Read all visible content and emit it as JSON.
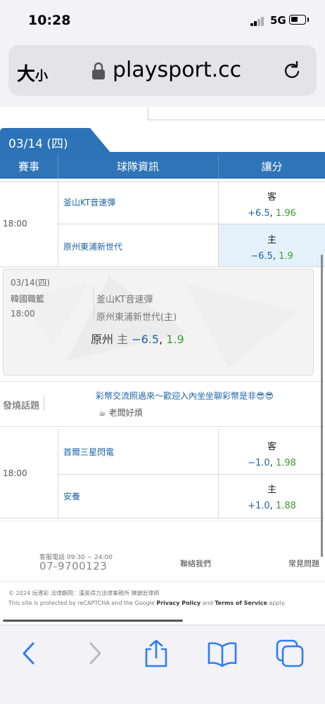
{
  "status_bar": {
    "time": "10:28",
    "network": "5G"
  },
  "browser": {
    "text_size_label": "大",
    "text_size_label_small": "小",
    "url": "playsport.cc"
  },
  "date_tab": {
    "label": "03/14 (四)"
  },
  "table": {
    "headers": [
      "賽事",
      "球隊資訊",
      "讓分"
    ],
    "matches": [
      {
        "time": "18:00",
        "away_team": "釜山KT音速彈",
        "away_side": "客",
        "away_line": "+6.5",
        "away_odds": "1.96",
        "home_team": "原州東浦新世代",
        "home_side": "主",
        "home_line": "−6.5",
        "home_odds": "1.9"
      },
      {
        "time": "18:00",
        "away_team": "首爾三星閃電",
        "away_side": "客",
        "away_line": "−1.0",
        "away_odds": "1.98",
        "home_team": "安養",
        "home_side": "主",
        "home_line": "+1.0",
        "home_odds": "1.88"
      }
    ]
  },
  "pick_card": {
    "date": "03/14(四)",
    "league": "韓國職籃",
    "time": "18:00",
    "team1": "釜山KT音速彈",
    "team2": "原州東浦新世代(主)",
    "pick_team": "原州",
    "pick_side": "主",
    "pick_line": "−6.5",
    "pick_sep": ",",
    "pick_odds": "1.9"
  },
  "topic": {
    "label": "發燒話題",
    "title": "彩幣交流照過來～歡迎入內坐坐聊彩幣是非😎😎",
    "author": "老闆好煩"
  },
  "footer": {
    "service_hours": "客服電話 09:30 ~ 24:00",
    "phone": "07-9700123",
    "contact_label": "聯絡我們",
    "faq_label": "常見問題",
    "copyright": "© 2024 玩運彩 法律顧問：漢英得力法律事務所 陳鎮宏律師",
    "recaptcha_prefix": "This site is protected by reCAPTCHA and the Google",
    "privacy_label": "Privacy Policy",
    "and_label": "and",
    "terms_label": "Terms of Service",
    "apply_label": "apply."
  },
  "colors": {
    "header_blue": "#2f74b6",
    "link_blue": "#1e63a6",
    "odds_green": "#3a9e2e",
    "highlight_bg": "#e4f1fb",
    "ios_blue": "#2f7cf6"
  },
  "toolbar": {
    "icons": [
      "back-icon",
      "forward-icon",
      "share-icon",
      "bookmarks-icon",
      "tabs-icon"
    ]
  }
}
